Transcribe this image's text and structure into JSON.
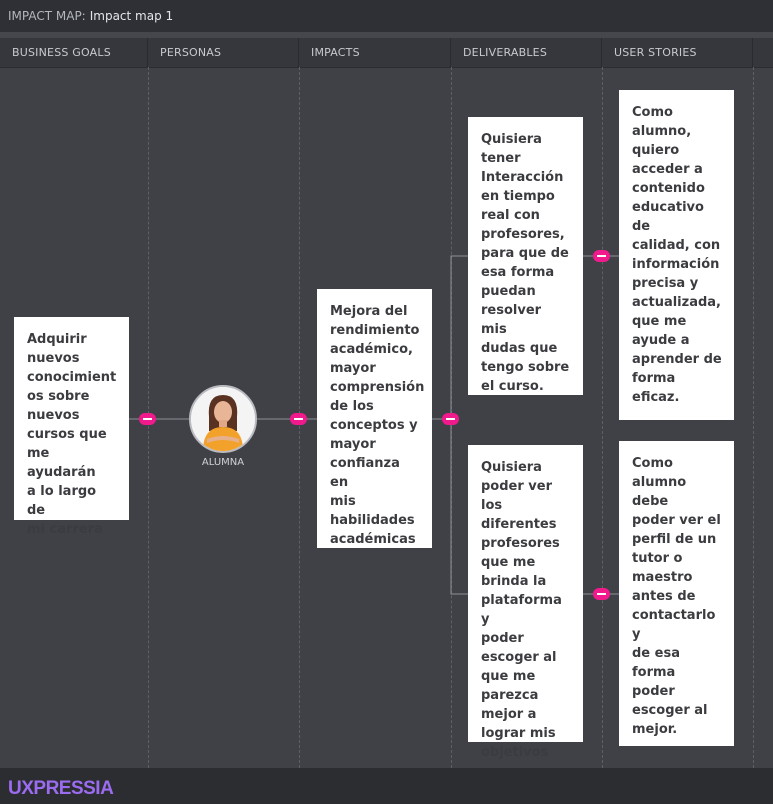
{
  "breadcrumb": {
    "label": "IMPACT MAP:",
    "name": "Impact map 1"
  },
  "columns": [
    "BUSINESS GOALS",
    "PERSONAS",
    "IMPACTS",
    "DELIVERABLES",
    "USER STORIES"
  ],
  "business_goal": "Adquirir\nnuevos\nconocimient\nos sobre\nnuevos\ncursos que\nme ayudarán\na lo largo de\nmi carrera",
  "persona": {
    "name": "ALUMNA",
    "avatar_icon": "person-avatar-icon"
  },
  "impact": "Mejora del\nrendimiento\nacadémico,\nmayor\ncomprensión\nde los\nconceptos y\nmayor\nconfianza en\nmis\nhabilidades\nacadémicas",
  "deliverables": [
    "Quisiera\n tener\nInteracción\nen tiempo\nreal con\nprofesores,\npara que de\nesa forma\npuedan\nresolver mis\ndudas que\ntengo sobre\nel curso.",
    "Quisiera\npoder ver los\ndiferentes\nprofesores\nque me\nbrinda la\nplataforma y\npoder\nescoger al\nque me\nparezca\nmejor a\nlograr mis\nobjetivos"
  ],
  "user_stories": [
    "Como\nalumno,\nquiero\nacceder a\ncontenido\neducativo de\ncalidad, con\ninformación\nprecisa y\nactualizada,\nque me\nayude a\naprender de\nforma eficaz.",
    "Como\nalumno debe\npoder ver el\nperfil de un\ntutor o\nmaestro\nantes de\ncontactarlo y\nde esa forma\npoder\nescoger al\nmejor."
  ],
  "logo": "UXPRESSIA",
  "colors": {
    "accent": "#f01a8d",
    "brand": "#9b6cf0"
  }
}
